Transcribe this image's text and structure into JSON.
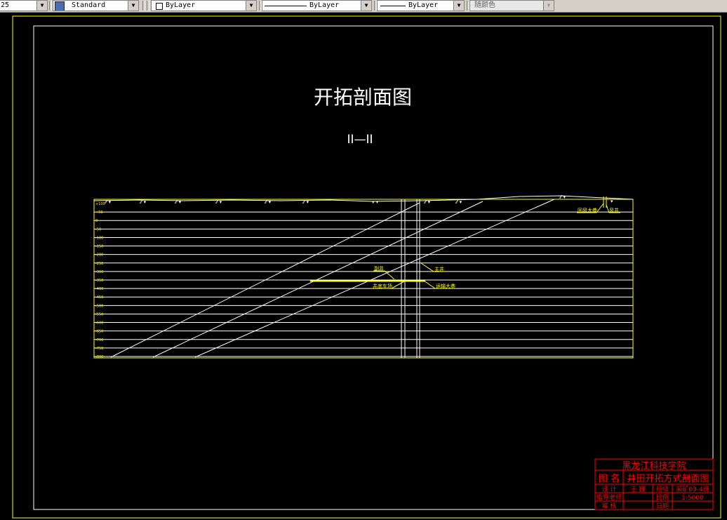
{
  "toolbar": {
    "item0": "25",
    "text_style": "Standard",
    "layer": "ByLayer",
    "linetype": "ByLayer",
    "lineweight": "ByLayer",
    "color": "随颜色"
  },
  "drawing": {
    "title": "开拓剖面图",
    "section": "II—II",
    "elevation_labels": [
      "+100",
      "+50",
      "0",
      "-50",
      "-100",
      "-150",
      "-200",
      "-250",
      "-300",
      "-350",
      "-400",
      "-450",
      "-500",
      "-550",
      "-600",
      "-650",
      "-700",
      "-750",
      "-800"
    ],
    "annotations": {
      "aux_shaft": "副井",
      "main_shaft": "主井",
      "shaft_bottom_yard": "井底车场",
      "main_haulage": "运输大巷",
      "ventilation_roadway": "回风大巷",
      "air_shaft": "风井"
    }
  },
  "title_block": {
    "school": "黑龙江科技学院",
    "name_label": "图  名",
    "name_value": "井田开拓方式剖面图",
    "design_label": "设  计",
    "designer": "王  巍",
    "class_label": "班级",
    "class_value": "采矿03-4班",
    "advisor_label": "指导老师",
    "scale_label": "比例",
    "scale_value": "1:5000",
    "review_label": "审  核",
    "date_label": "日期"
  },
  "colors": {
    "background": "#000000",
    "line": "#ffffff",
    "layer_yellow": "#ffff00",
    "title_block": "#ff0000"
  }
}
